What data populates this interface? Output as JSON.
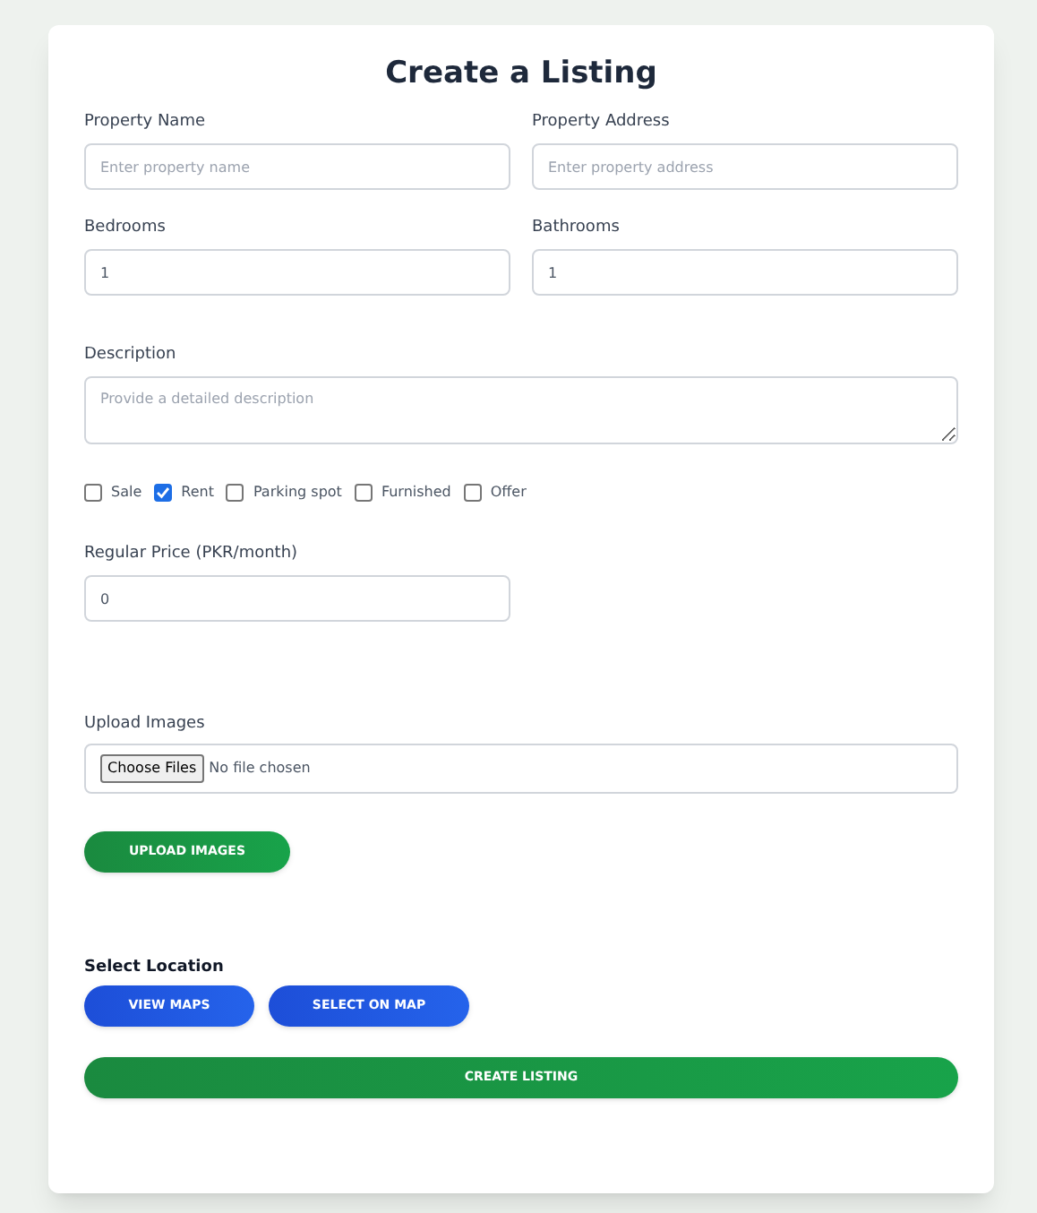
{
  "title": "Create a Listing",
  "fields": [
    {
      "label": "Property Name",
      "placeholder": "Enter property name"
    },
    {
      "label": "Property Address",
      "placeholder": "Enter property address"
    },
    {
      "label": "Bedrooms",
      "value": "1"
    },
    {
      "label": "Bathrooms",
      "value": "1"
    }
  ],
  "description": {
    "label": "Description",
    "placeholder": "Provide a detailed description"
  },
  "options": [
    {
      "label": "Sale",
      "checked": false
    },
    {
      "label": "Rent",
      "checked": true
    },
    {
      "label": "Parking spot",
      "checked": false
    },
    {
      "label": "Furnished",
      "checked": false
    },
    {
      "label": "Offer",
      "checked": false
    }
  ],
  "price": {
    "label": "Regular Price (PKR/month)",
    "value": "0"
  },
  "upload": {
    "label": "Upload Images",
    "choose_button": "Choose Files",
    "file_status": "No file chosen",
    "button": "UPLOAD IMAGES"
  },
  "location": {
    "label": "Select Location",
    "buttons": [
      "VIEW MAPS",
      "SELECT ON MAP"
    ]
  },
  "submit": "CREATE LISTING"
}
